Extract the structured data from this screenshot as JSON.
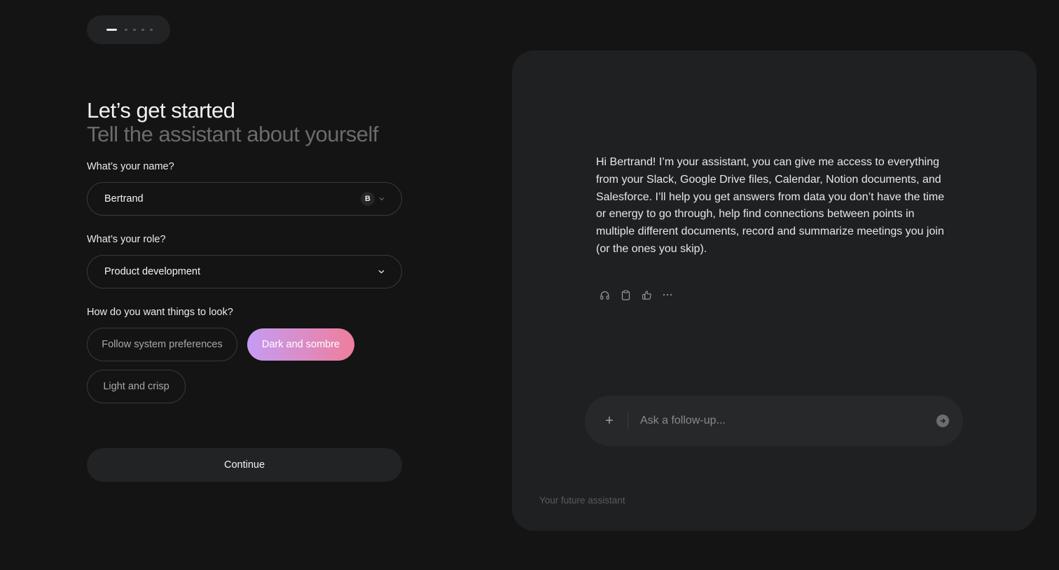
{
  "progress": {
    "current_step": 1,
    "total_steps": 5
  },
  "header": {
    "title": "Let’s get started",
    "subtitle": "Tell the assistant about yourself"
  },
  "form": {
    "name": {
      "label": "What’s your name?",
      "value": "Bertrand",
      "avatar_initial": "B"
    },
    "role": {
      "label": "What’s your role?",
      "selected": "Product development"
    },
    "appearance": {
      "label": "How do you want things to look?",
      "options": [
        {
          "label": "Follow system preferences",
          "selected": false
        },
        {
          "label": "Dark and sombre",
          "selected": true
        },
        {
          "label": "Light and crisp",
          "selected": false
        }
      ]
    },
    "continue_label": "Continue"
  },
  "preview": {
    "message": "Hi Bertrand! I’m your assistant, you can give me access to everything from your Slack, Google Drive files, Calendar, Notion documents, and Salesforce. I’ll help you get answers from data you don’t have the time or energy to go through, help find connections between points in multiple different documents, record and summarize meetings you join (or the ones you skip).",
    "actions": [
      "headphones-icon",
      "clipboard-icon",
      "thumbs-up-icon",
      "more-icon"
    ],
    "composer": {
      "add_symbol": "+",
      "placeholder": "Ask a follow-up..."
    },
    "footer_label": "Your future assistant"
  },
  "colors": {
    "background": "#141414",
    "panel": "#1f2022",
    "accent_gradient_start": "#c59cf4",
    "accent_gradient_end": "#ef7e9c"
  }
}
